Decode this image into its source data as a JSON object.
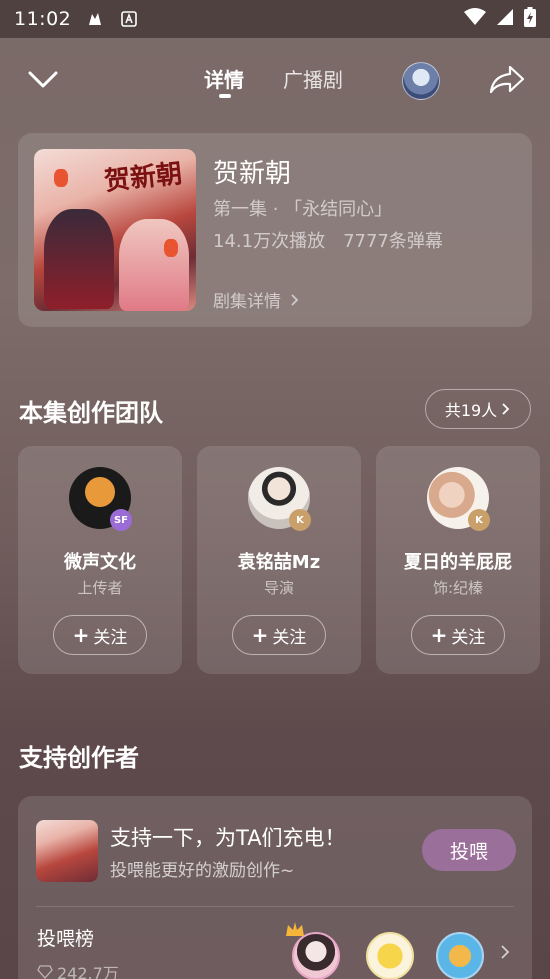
{
  "status_bar": {
    "time": "11:02"
  },
  "nav": {
    "tabs": [
      {
        "label": "详情",
        "active": true
      },
      {
        "label": "广播剧",
        "active": false
      }
    ]
  },
  "episode": {
    "title": "贺新朝",
    "subtitle": "第一集 · 「永结同心」",
    "plays": "14.1万次播放",
    "danmaku": "7777条弹幕",
    "detail_link": "剧集详情",
    "cover_text": "贺新朝"
  },
  "team": {
    "title": "本集创作团队",
    "total_label": "共19人",
    "members": [
      {
        "name": "微声文化",
        "role": "上传者",
        "badge": "SF",
        "follow_label": "关注"
      },
      {
        "name": "袁铭喆Mz",
        "role": "导演",
        "badge": "K",
        "follow_label": "关注"
      },
      {
        "name": "夏日的羊屁屁",
        "role": "饰:纪榛",
        "badge": "K",
        "follow_label": "关注"
      }
    ]
  },
  "support": {
    "title": "支持创作者",
    "headline": "支持一下，为TA们充电！",
    "subline": "投喂能更好的激励创作~",
    "feed_button": "投喂",
    "rank_label": "投喂榜",
    "rank_value": "242.7万"
  },
  "colors": {
    "feed_button": "#9a6f9a",
    "sf_badge": "#9b6bd6",
    "k_badge": "#c9a06a"
  }
}
